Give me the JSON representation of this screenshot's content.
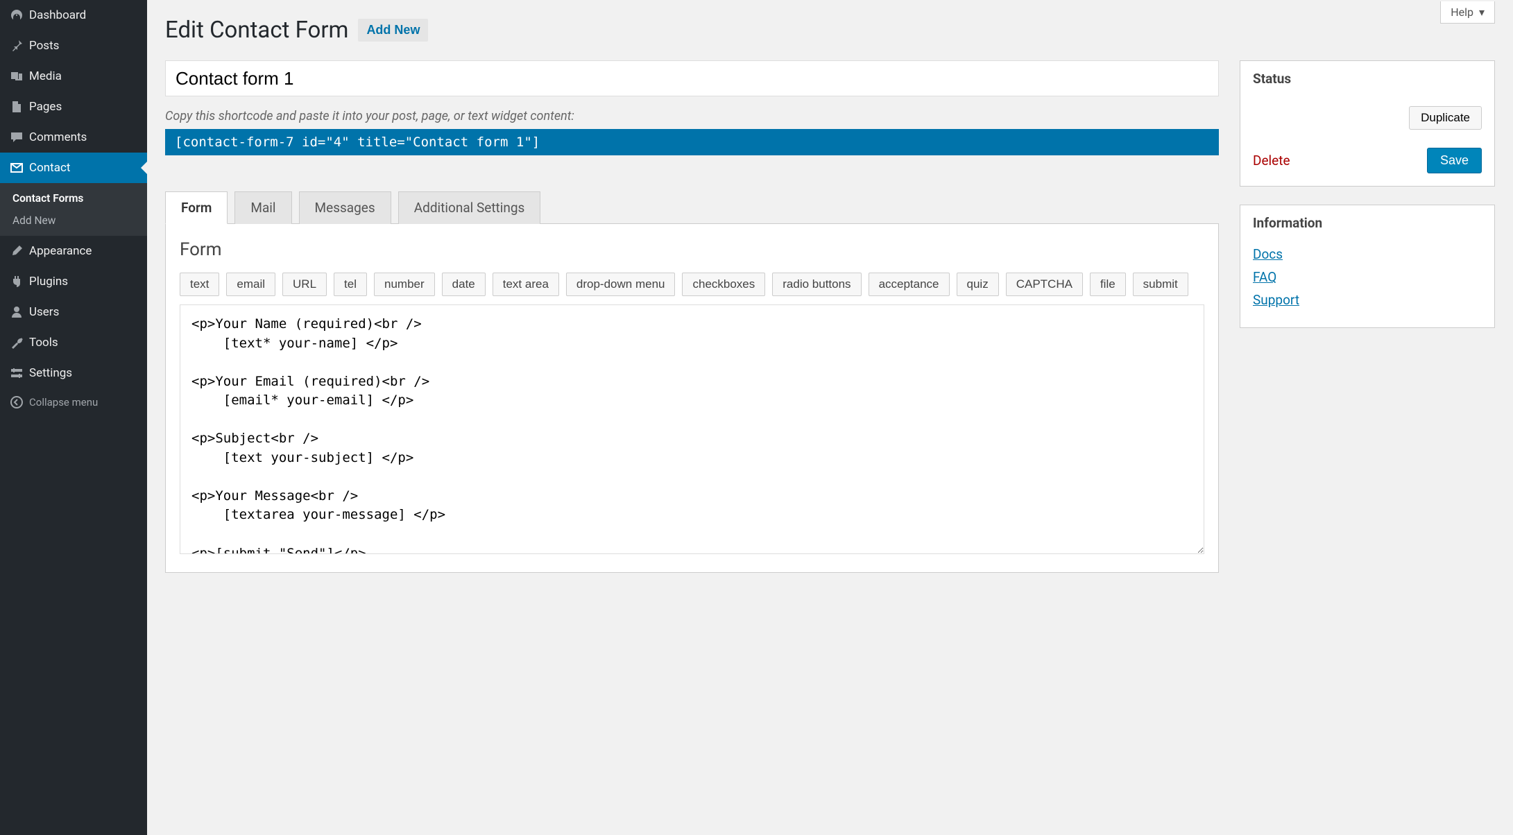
{
  "help": "Help",
  "sidebar": {
    "dashboard": "Dashboard",
    "posts": "Posts",
    "media": "Media",
    "pages": "Pages",
    "comments": "Comments",
    "contact": "Contact",
    "contact_forms": "Contact Forms",
    "add_new": "Add New",
    "appearance": "Appearance",
    "plugins": "Plugins",
    "users": "Users",
    "tools": "Tools",
    "settings": "Settings",
    "collapse": "Collapse menu"
  },
  "header": {
    "title": "Edit Contact Form",
    "add_new": "Add New"
  },
  "form_title": "Contact form 1",
  "shortcode_hint": "Copy this shortcode and paste it into your post, page, or text widget content:",
  "shortcode": "[contact-form-7 id=\"4\" title=\"Contact form 1\"]",
  "tabs": {
    "form": "Form",
    "mail": "Mail",
    "messages": "Messages",
    "additional": "Additional Settings"
  },
  "panel": {
    "title": "Form",
    "tags": [
      "text",
      "email",
      "URL",
      "tel",
      "number",
      "date",
      "text area",
      "drop-down menu",
      "checkboxes",
      "radio buttons",
      "acceptance",
      "quiz",
      "CAPTCHA",
      "file",
      "submit"
    ],
    "code": "<p>Your Name (required)<br />\n    [text* your-name] </p>\n\n<p>Your Email (required)<br />\n    [email* your-email] </p>\n\n<p>Subject<br />\n    [text your-subject] </p>\n\n<p>Your Message<br />\n    [textarea your-message] </p>\n\n<p>[submit \"Send\"]</p>"
  },
  "status": {
    "heading": "Status",
    "duplicate": "Duplicate",
    "delete": "Delete",
    "save": "Save"
  },
  "info": {
    "heading": "Information",
    "docs": "Docs",
    "faq": "FAQ",
    "support": "Support"
  }
}
